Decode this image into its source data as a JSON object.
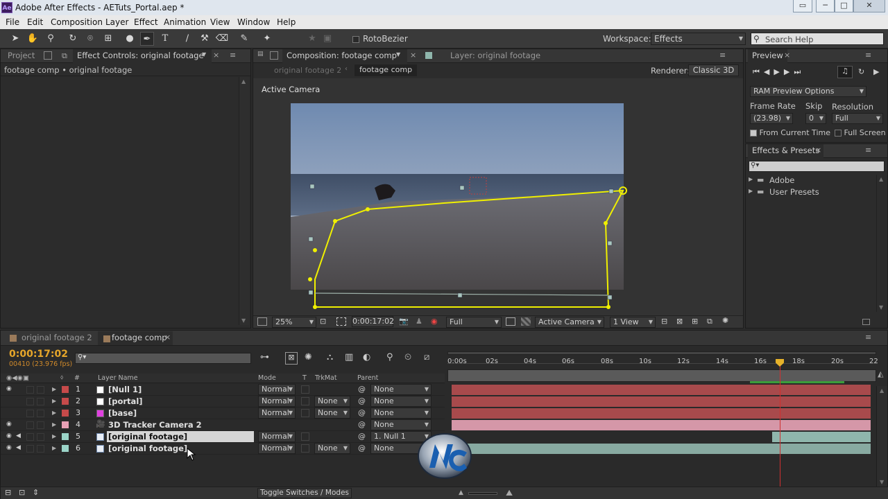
{
  "window": {
    "title": "Adobe After Effects - AETuts_Portal.aep *",
    "app_badge": "Ae",
    "min": "─",
    "max": "□",
    "close": "✕"
  },
  "menu": [
    "File",
    "Edit",
    "Composition",
    "Layer",
    "Effect",
    "Animation",
    "View",
    "Window",
    "Help"
  ],
  "toolbar": {
    "rotobezier": "RotoBezier",
    "workspace_label": "Workspace:",
    "workspace_value": "Effects",
    "search_placeholder": "Search Help"
  },
  "left_panel": {
    "tab_project": "Project",
    "tab_effect": "Effect Controls: original footage",
    "breadcrumb": "footage comp • original footage"
  },
  "comp_panel": {
    "tab_comp": "Composition: footage comp",
    "tab_layer": "Layer: original footage",
    "nav_prev": "original footage 2",
    "nav_current": "footage comp",
    "renderer_label": "Renderer:",
    "renderer_value": "Classic 3D",
    "view_label": "Active Camera",
    "zoom": "25%",
    "timecode": "0:00:17:02",
    "resolution": "Full",
    "camera": "Active Camera",
    "views": "1 View"
  },
  "preview": {
    "title": "Preview",
    "ram_options": "RAM Preview Options",
    "frame_rate_label": "Frame Rate",
    "skip_label": "Skip",
    "resolution_label": "Resolution",
    "frame_rate": "(23.98)",
    "skip": "0",
    "resolution": "Full",
    "from_current": "From Current Time",
    "full_screen": "Full Screen"
  },
  "effects": {
    "title": "Effects & Presets",
    "search_placeholder": "",
    "items": [
      "Adobe",
      "User Presets"
    ]
  },
  "timeline": {
    "tabs": [
      "original footage 2",
      "footage comp"
    ],
    "timecode": "0:00:17:02",
    "frames": "00410 (23.976 fps)",
    "search_placeholder": "",
    "headers": {
      "num": "#",
      "name": "Layer Name",
      "mode": "Mode",
      "t": "T",
      "trkmat": "TrkMat",
      "parent": "Parent"
    },
    "ruler": [
      "0:00s",
      "02s",
      "04s",
      "06s",
      "08s",
      "10s",
      "12s",
      "14s",
      "16s",
      "18s",
      "20s",
      "22"
    ],
    "toggle": "Toggle Switches / Modes",
    "layers": [
      {
        "num": "1",
        "name": "[Null 1]",
        "mode": "Normal",
        "trkmat": "",
        "parent": "None",
        "label_color": "#c64a4a",
        "swatch": "#ffffff",
        "bar_color": "#a84a4c",
        "bar_start": 0.0,
        "bar_end": 1.0
      },
      {
        "num": "2",
        "name": "[portal]",
        "mode": "Normal",
        "trkmat": "None",
        "parent": "None",
        "label_color": "#c64a4a",
        "swatch": "#ffffff",
        "bar_color": "#a84a4c",
        "bar_start": 0.0,
        "bar_end": 1.0
      },
      {
        "num": "3",
        "name": "[base]",
        "mode": "Normal",
        "trkmat": "None",
        "parent": "None",
        "label_color": "#c64a4a",
        "swatch": "#e040e0",
        "bar_color": "#a84a4c",
        "bar_start": 0.0,
        "bar_end": 1.0
      },
      {
        "num": "4",
        "name": "3D Tracker Camera 2",
        "mode": "",
        "trkmat": "",
        "parent": "None",
        "label_color": "#e7a0b5",
        "swatch": "",
        "bar_color": "#d597a8",
        "bar_start": 0.0,
        "bar_end": 1.0
      },
      {
        "num": "5",
        "name": "[original footage]",
        "mode": "Normal",
        "trkmat": "",
        "parent": "1. Null 1",
        "label_color": "#9bd4c8",
        "swatch": "",
        "bar_color": "#8fb6ac",
        "bar_start": 0.765,
        "bar_end": 1.0
      },
      {
        "num": "6",
        "name": "[original footage]",
        "mode": "Normal",
        "trkmat": "None",
        "parent": "None",
        "label_color": "#9bd4c8",
        "swatch": "",
        "bar_color": "#88aaa1",
        "bar_start": 0.0,
        "bar_end": 1.0
      }
    ]
  }
}
